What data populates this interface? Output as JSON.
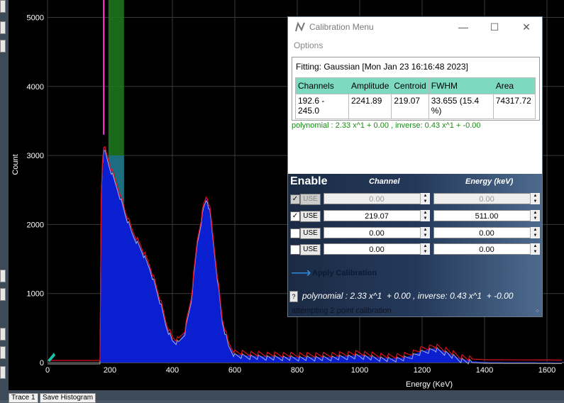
{
  "plot": {
    "y_ticks": [
      "0",
      "1000",
      "2000",
      "3000",
      "4000",
      "5000"
    ],
    "x_ticks": [
      "0",
      "200",
      "400",
      "600",
      "800",
      "1000",
      "1200",
      "1400",
      "1600"
    ],
    "y_label": "Count",
    "x_label": "Energy (KeV)",
    "colors": {
      "fill": "#0a1fd0",
      "outline_red": "#e01020",
      "outline_white": "#e8e8e8",
      "roi_green": "#1f7a1f",
      "roi_cyan": "#1e6d8c",
      "grid": "#3a3a3a"
    }
  },
  "calibration_window": {
    "title": "Calibration Menu",
    "menu_options": "Options",
    "fit_header": "Fitting: Gaussian [Mon Jan 23 16:16:48 2023]",
    "columns": [
      "Channels",
      "Amplitude",
      "Centroid",
      "FWHM",
      "Area"
    ],
    "fit_row": [
      "192.6 - 245.0",
      "2241.89",
      "219.07",
      "33.655 (15.4 %)",
      "74317.72"
    ],
    "polynomial_green": "polynomial : 2.33 x^1 + 0.00 , inverse: 0.43 x^1 + -0.00",
    "enable_header": "Enable",
    "channel_header": "Channel",
    "energy_header": "Energy (keV)",
    "use_label": "USE",
    "rows": [
      {
        "checked": true,
        "disabled": true,
        "channel": "0.00",
        "energy": "0.00"
      },
      {
        "checked": true,
        "disabled": false,
        "channel": "219.07",
        "energy": "511.00"
      },
      {
        "checked": false,
        "disabled": false,
        "channel": "0.00",
        "energy": "0.00"
      },
      {
        "checked": false,
        "disabled": false,
        "channel": "0.00",
        "energy": "0.00"
      }
    ],
    "apply_label": "Apply Calibration",
    "help_label": "?",
    "polynomial_white": "polynomial : 2.33 x^1  + 0.00 , inverse: 0.43 x^1  + -0.00",
    "status": "attempting 2 point calibration"
  },
  "bottom_tabs": [
    "Trace 1",
    "Save Histogram"
  ]
}
